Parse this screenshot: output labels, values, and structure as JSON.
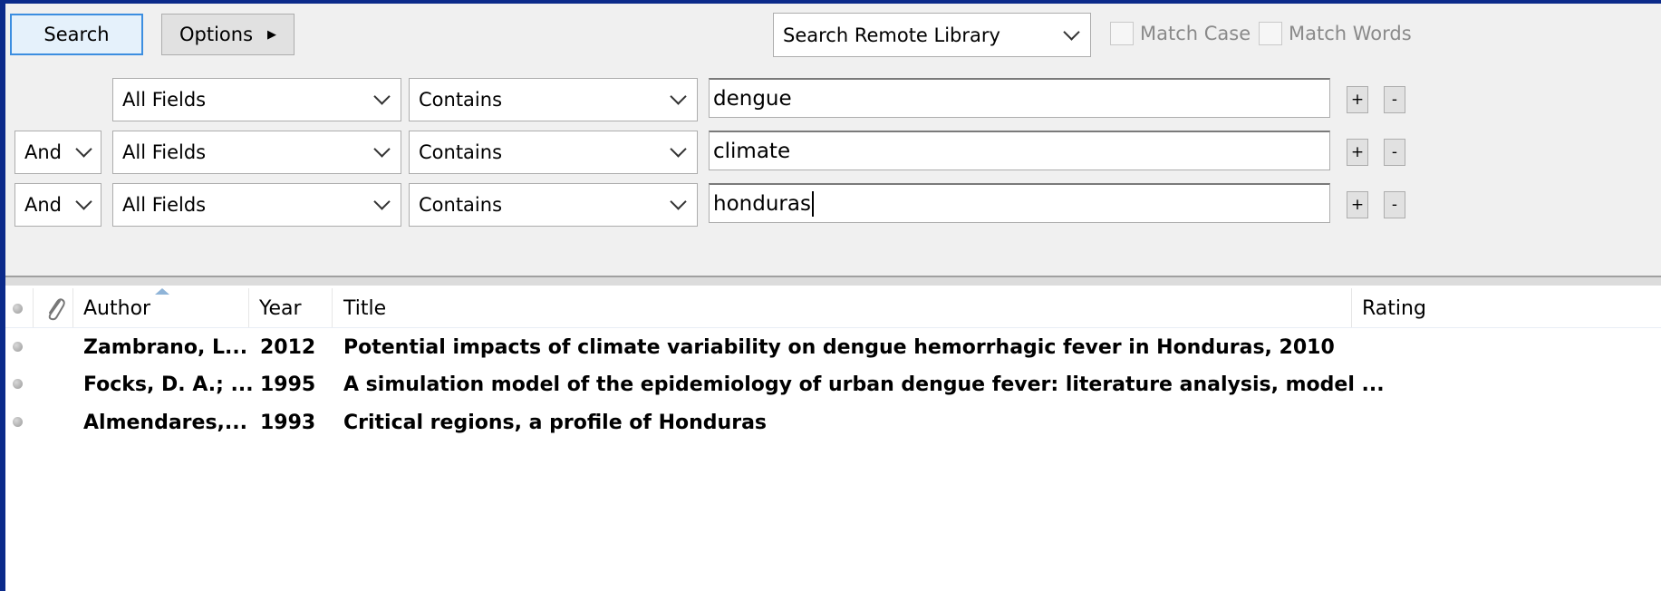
{
  "toolbar": {
    "search_label": "Search",
    "options_label": "Options",
    "library_select": "Search Remote Library",
    "match_case_label": "Match Case",
    "match_words_label": "Match Words"
  },
  "criteria": [
    {
      "operator": "",
      "field": "All Fields",
      "condition": "Contains",
      "value": "dengue",
      "plus": "+",
      "minus": "-"
    },
    {
      "operator": "And",
      "field": "All Fields",
      "condition": "Contains",
      "value": "climate",
      "plus": "+",
      "minus": "-"
    },
    {
      "operator": "And",
      "field": "All Fields",
      "condition": "Contains",
      "value": "honduras",
      "plus": "+",
      "minus": "-"
    }
  ],
  "results": {
    "columns": {
      "author": "Author",
      "year": "Year",
      "title": "Title",
      "rating": "Rating"
    },
    "rows": [
      {
        "author": "Zambrano, L...",
        "year": "2012",
        "title": "Potential impacts of climate variability on dengue hemorrhagic fever in Honduras, 2010"
      },
      {
        "author": "Focks, D. A.; ...",
        "year": "1995",
        "title": "A simulation model of the epidemiology of urban dengue fever: literature analysis, model ..."
      },
      {
        "author": "Almendares,...",
        "year": "1993",
        "title": "Critical regions, a profile of Honduras"
      }
    ]
  },
  "icons": {
    "options_arrow": "triangle-right-icon",
    "dropdown": "chevron-down-icon",
    "read_status": "dot-icon",
    "attachment": "paperclip-icon",
    "sort": "sort-ascending-icon"
  }
}
